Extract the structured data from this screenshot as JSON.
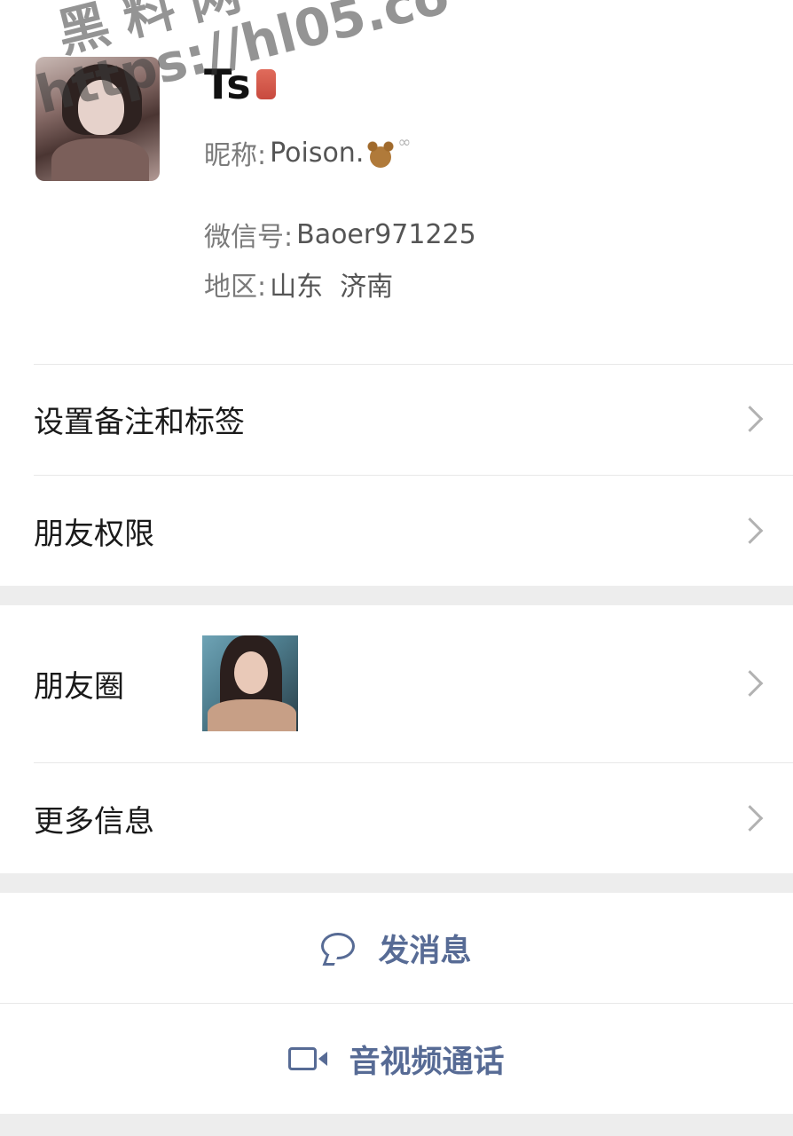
{
  "profile": {
    "display_name": "Ts",
    "nickname_label": "昵称:",
    "nickname_value": "Poison.",
    "wechat_id_label": "微信号:",
    "wechat_id_value": "Baoer971225",
    "region_label": "地区:",
    "region_value": "山东  济南"
  },
  "menu_group_1": [
    {
      "label": "设置备注和标签"
    },
    {
      "label": "朋友权限"
    }
  ],
  "menu_group_2": [
    {
      "label": "朋友圈"
    },
    {
      "label": "更多信息"
    }
  ],
  "actions": {
    "message_label": "发消息",
    "call_label": "音视频通话"
  },
  "watermark": {
    "line1": "黑料网",
    "line2": "https://hl05.co"
  },
  "colors": {
    "accent": "#576b95",
    "background": "#ededed",
    "card": "#ffffff"
  },
  "icons": [
    "chevron-right-icon",
    "chat-bubble-icon",
    "video-camera-icon",
    "teddy-bear-icon"
  ]
}
